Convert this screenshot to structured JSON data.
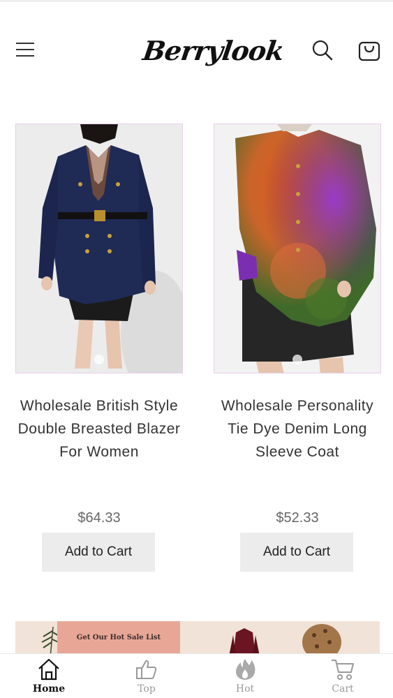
{
  "header": {
    "logo_text": "Berrylook",
    "icons": [
      "menu-icon",
      "search-icon",
      "shopping-bag-icon"
    ]
  },
  "products": [
    {
      "title": "Wholesale British Style Double Breasted Blazer For Women",
      "price": "$64.33",
      "button_label": "Add to Cart",
      "image": "navy-blazer-photo"
    },
    {
      "title": "Wholesale Personality Tie Dye Denim Long Sleeve Coat",
      "price": "$52.33",
      "button_label": "Add to Cart",
      "image": "tie-dye-coat-photo"
    }
  ],
  "banner": {
    "text": "Get Our Hot Sale List"
  },
  "bottom_nav": [
    {
      "label": "Home",
      "icon": "home-icon",
      "active": true
    },
    {
      "label": "Top",
      "icon": "thumbs-up-icon",
      "active": false
    },
    {
      "label": "Hot",
      "icon": "flame-icon",
      "active": false
    },
    {
      "label": "Cart",
      "icon": "cart-icon",
      "active": false
    }
  ],
  "colors": {
    "card_border": "#e6cfe8",
    "button_bg": "#ececec",
    "blazer": "#1f2a55",
    "banner_pink": "#e8a796"
  }
}
